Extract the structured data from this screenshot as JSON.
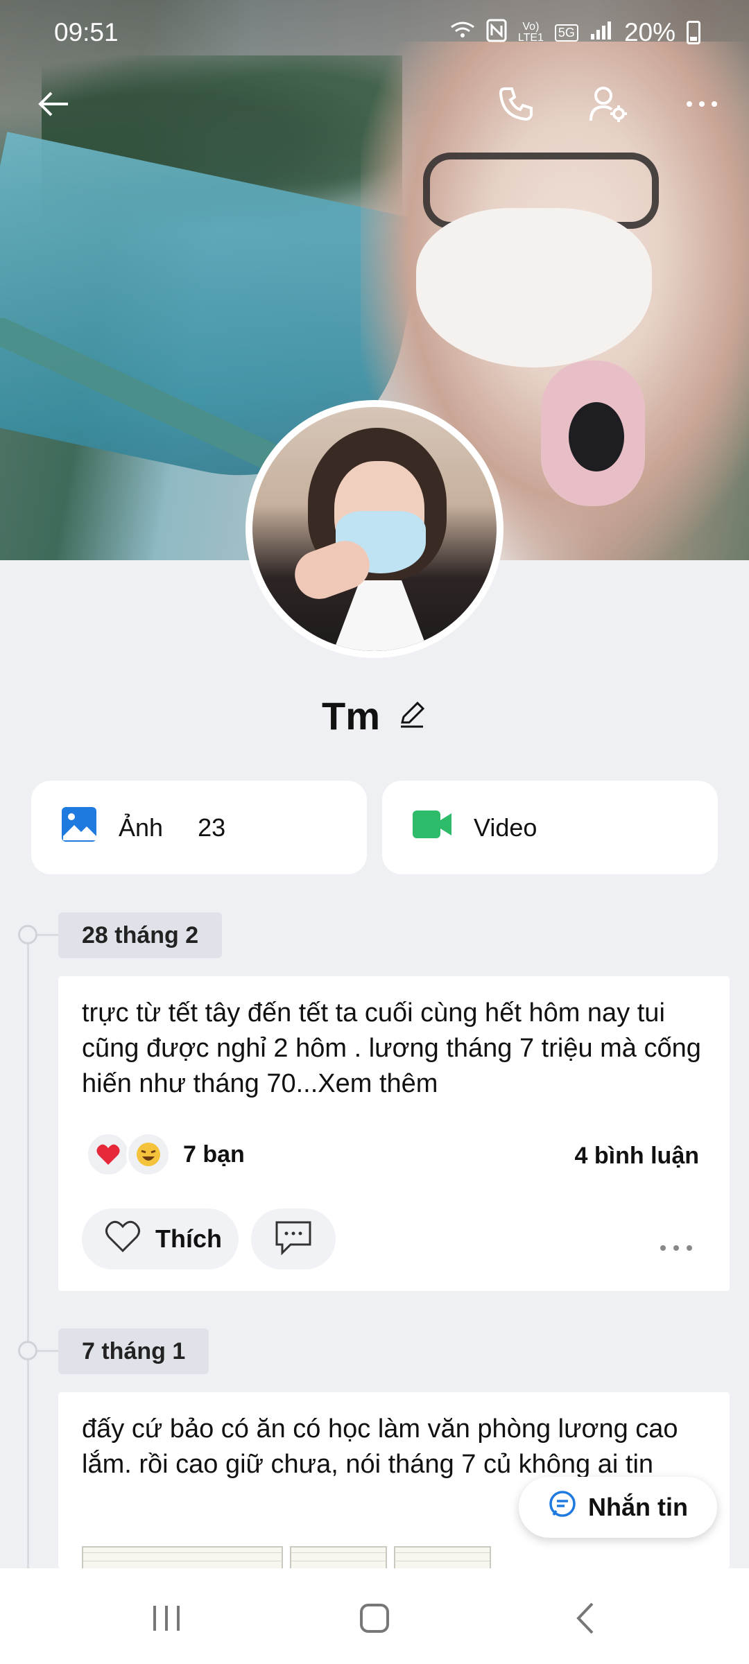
{
  "status_bar": {
    "time": "09:51",
    "indicators": [
      "wifi-icon",
      "nfc-icon",
      "volte-icon",
      "5g-icon",
      "signal-icon"
    ],
    "volte_label": "Vo)",
    "lte_label": "LTE1",
    "network_label": "5G",
    "battery": "20%"
  },
  "header": {
    "back_icon": "back-arrow-icon",
    "call_icon": "phone-icon",
    "settings_icon": "user-settings-icon",
    "more_icon": "more-horizontal-icon"
  },
  "profile": {
    "name": "Tm",
    "edit_icon": "pencil-icon"
  },
  "media": {
    "photos_label": "Ảnh",
    "photos_count": "23",
    "video_label": "Video"
  },
  "feed": [
    {
      "date": "28 tháng 2",
      "text": "trực từ tết tây đến tết ta cuối cùng hết hôm nay tui cũng được nghỉ 2 hôm . lương tháng 7 triệu mà cống hiến như tháng 70...Xem thêm",
      "reaction_count": "7 bạn",
      "comment_count": "4 bình luận",
      "like_label": "Thích"
    },
    {
      "date": "7 tháng 1",
      "text": "đấy cứ bảo có ăn có học làm văn phòng lương cao lắm. rồi cao giữ chưa, nói tháng 7 củ không ai tin"
    }
  ],
  "fab": {
    "message_label": "Nhắn tin"
  },
  "colors": {
    "accent_blue": "#1f7ae0",
    "video_green": "#2dbb6a",
    "background": "#eef0f4"
  }
}
